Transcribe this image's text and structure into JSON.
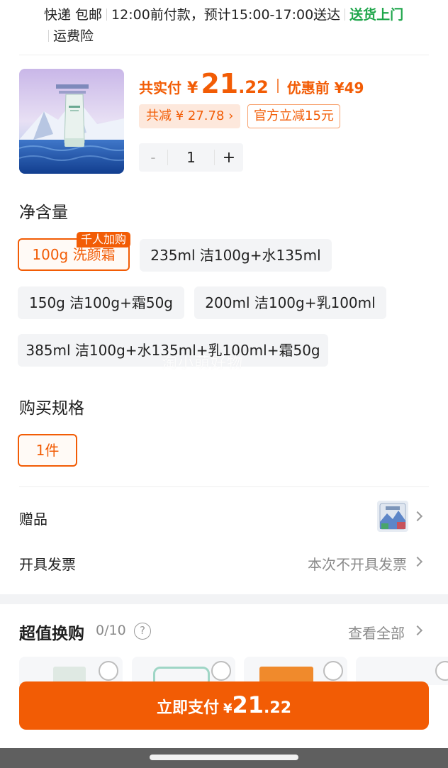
{
  "delivery": {
    "method": "快递 包邮",
    "schedule": "12:00前付款，预计15:00-17:00送达",
    "door": "送货上门",
    "insurance": "运费险"
  },
  "product": {
    "image_alt": "icon-product-cleanser"
  },
  "price": {
    "total_label": "共实付",
    "currency": "¥",
    "total_int": "21",
    "total_dec": ".22",
    "before_label": "优惠前 ¥49",
    "reduce_label": "共减 ¥ 27.78 ›",
    "official_label": "官方立减15元"
  },
  "quantity": {
    "minus": "-",
    "value": "1",
    "plus": "+"
  },
  "net_content": {
    "title": "净含量",
    "hot_tag": "千人加购",
    "options": [
      "100g 洗颜霜",
      "235ml 洁100g+水135ml",
      "150g 洁100g+霜50g",
      "200ml 洁100g+乳100ml",
      "385ml 洁100g+水135ml+乳100ml+霜50g"
    ],
    "selected_index": 0
  },
  "watermark": "淘小萌好物",
  "spec": {
    "title": "购买规格",
    "options": [
      "1件"
    ],
    "selected_index": 0
  },
  "gift": {
    "label": "赠品"
  },
  "invoice": {
    "label": "开具发票",
    "value": "本次不开具发票"
  },
  "swap": {
    "title": "超值换购",
    "count": "0/10",
    "help": "?",
    "view_all": "查看全部"
  },
  "pay": {
    "label": "立即支付",
    "currency": "¥",
    "int": "21",
    "dec": ".22"
  },
  "colors": {
    "accent": "#f25c05",
    "green": "#1fa64b"
  }
}
